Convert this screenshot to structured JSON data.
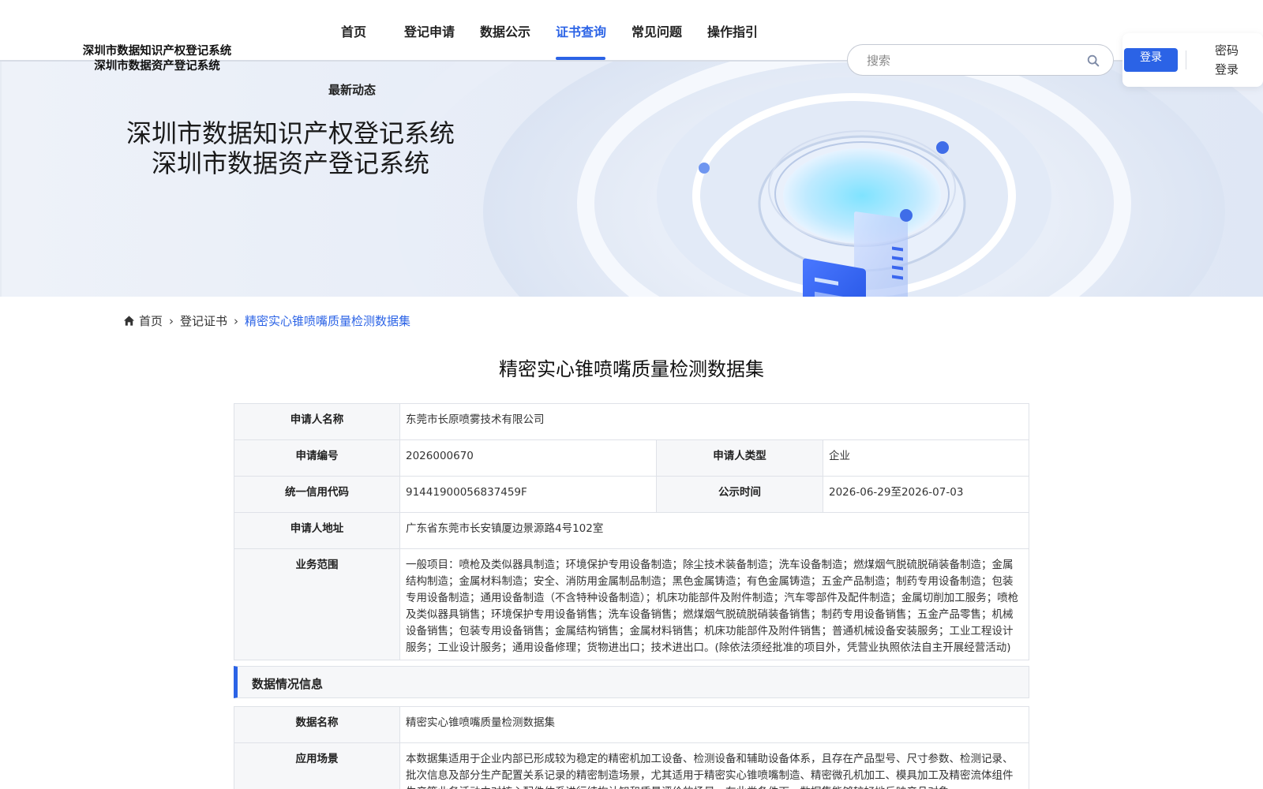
{
  "header": {
    "logo_line1": "深圳市数据知识产权登记系统",
    "logo_line2": "深圳市数据资产登记系统",
    "nav": [
      {
        "label": "首页"
      },
      {
        "label": "登记申请"
      },
      {
        "label": "数据公示"
      },
      {
        "label": "证书查询"
      },
      {
        "label": "常见问题"
      },
      {
        "label": "操作指引"
      }
    ],
    "nav_active_index": 3,
    "nav_sub": "最新动态",
    "search_placeholder": "搜索",
    "login_label": "登录",
    "password_login_label": "密码登录",
    "accent_color": "#2b63e6"
  },
  "banner": {
    "title_line1": "深圳市数据知识产权登记系统",
    "title_line2": "深圳市数据资产登记系统"
  },
  "breadcrumb": {
    "home": "首页",
    "level2": "登记证书",
    "current": "精密实心锥喷嘴质量检测数据集"
  },
  "detail": {
    "title": "精密实心锥喷嘴质量检测数据集",
    "applicant_name_label": "申请人名称",
    "applicant_name": "东莞市长原喷雾技术有限公司",
    "application_no_label": "申请编号",
    "application_no": "2026000670",
    "applicant_type_label": "申请人类型",
    "applicant_type": "企业",
    "credit_code_label": "统一信用代码",
    "credit_code": "91441900056837459F",
    "publicity_time_label": "公示时间",
    "publicity_time": "2026-06-29至2026-07-03",
    "address_label": "申请人地址",
    "address": "广东省东莞市长安镇厦边景源路4号102室",
    "business_scope_label": "业务范围",
    "business_scope": "一般项目：喷枪及类似器具制造；环境保护专用设备制造；除尘技术装备制造；洗车设备制造；燃煤烟气脱硫脱硝装备制造；金属结构制造；金属材料制造；安全、消防用金属制品制造；黑色金属铸造；有色金属铸造；五金产品制造；制药专用设备制造；包装专用设备制造；通用设备制造（不含特种设备制造）；机床功能部件及附件制造；汽车零部件及配件制造；金属切削加工服务；喷枪及类似器具销售；环境保护专用设备销售；洗车设备销售；燃煤烟气脱硫脱硝装备销售；制药专用设备销售；五金产品零售；机械设备销售；包装专用设备销售；金属结构销售；金属材料销售；机床功能部件及附件销售；普通机械设备安装服务；工业工程设计服务；工业设计服务；通用设备修理；货物进出口；技术进出口。(除依法须经批准的项目外，凭营业执照依法自主开展经营活动)"
  },
  "data_section": {
    "heading": "数据情况信息",
    "data_name_label": "数据名称",
    "data_name": "精密实心锥喷嘴质量检测数据集",
    "scenario_label": "应用场景",
    "scenario": "本数据集适用于企业内部已形成较为稳定的精密机加工设备、检测设备和辅助设备体系，且存在产品型号、尺寸参数、检测记录、批次信息及部分生产配置关系记录的精密制造场景，尤其适用于精密实心锥喷嘴制造、精密微孔机加工、模具加工及精密流体组件生产等业务活动中对核心配件体系进行结构认知和质量评价的场景。在此类条件下，数据集能够较好地反映产品对象"
  }
}
